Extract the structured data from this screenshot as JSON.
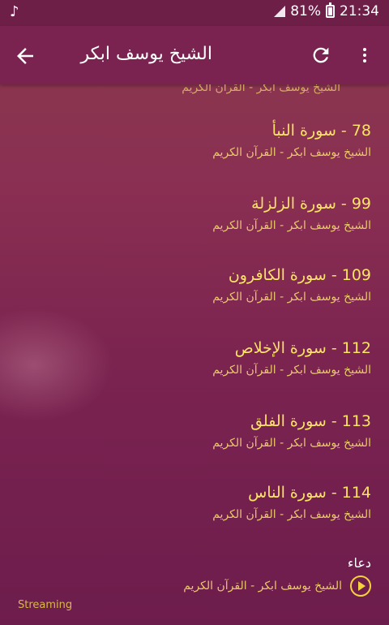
{
  "status": {
    "battery": "81%",
    "time": "21:34"
  },
  "appbar": {
    "title": "الشيخ يوسف ابكر"
  },
  "partial_item": {
    "subtitle": "الشيخ يوسف ابكر - القرآن الكريم"
  },
  "items": [
    {
      "title": "78 - سورة النبأ",
      "subtitle": "الشيخ يوسف ابكر - القرآن الكريم"
    },
    {
      "title": "99 - سورة الزلزلة",
      "subtitle": "الشيخ يوسف ابكر - القرآن الكريم"
    },
    {
      "title": "109 - سورة الكافرون",
      "subtitle": "الشيخ يوسف ابكر - القرآن الكريم"
    },
    {
      "title": "112 - سورة الإخلاص",
      "subtitle": "الشيخ يوسف ابكر - القرآن الكريم"
    },
    {
      "title": "113 - سورة الفلق",
      "subtitle": "الشيخ يوسف ابكر - القرآن الكريم"
    },
    {
      "title": "114 - سورة الناس",
      "subtitle": "الشيخ يوسف ابكر - القرآن الكريم"
    }
  ],
  "dua": {
    "title": "دعاء",
    "subtitle": "الشيخ يوسف ابكر - القرآن الكريم"
  },
  "footer": {
    "streaming": "Streaming"
  }
}
